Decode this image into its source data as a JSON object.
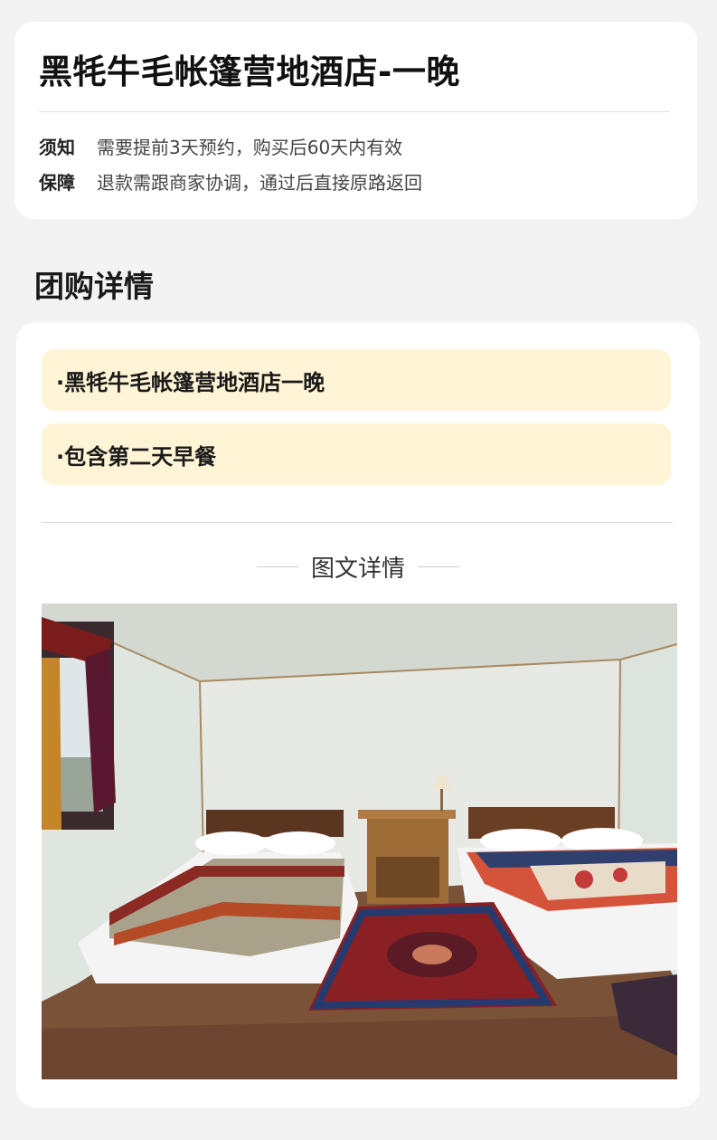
{
  "product": {
    "title": "黑牦牛毛帐篷营地酒店-一晚",
    "notice_label": "须知",
    "notice_text": "需要提前3天预约，购买后60天内有效",
    "guarantee_label": "保障",
    "guarantee_text": "退款需跟商家协调，通过后直接原路返回"
  },
  "group_buy": {
    "heading": "团购详情",
    "items": [
      "·黑牦牛毛帐篷营地酒店一晚",
      "·包含第二天早餐"
    ],
    "details_heading": "图文详情"
  },
  "photo": {
    "icon": "room-photo",
    "colors": {
      "wall": "#e3e7e1",
      "ceiling": "#d5dad3",
      "floor": "#7a5238",
      "rug": "#8a1f24"
    }
  }
}
